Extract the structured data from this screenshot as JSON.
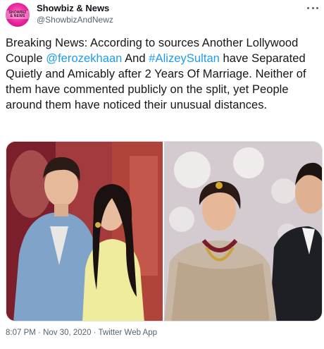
{
  "account": {
    "display_name": "Showbiz & News",
    "handle": "@ShowbizAndNewz",
    "avatar_text": "SHOWBIZ & NEWS",
    "avatar_color": "#e8249b"
  },
  "tweet": {
    "text_part1": "Breaking News: According to sources Another Lollywood Couple ",
    "mention1": "@ferozekhaan",
    "text_part2": " And ",
    "mention2": "#AlizeySultan",
    "text_part3": " have Separated Quietly and Amicably after 2 Years Of Marriage. Neither of them have commented publicly on the split, yet People around them have noticed their unusual distances.",
    "link_color": "#1d9bf0"
  },
  "media": {
    "photo_left": "couple-photo-left",
    "photo_right": "couple-photo-right"
  },
  "meta": {
    "time": "8:07 PM",
    "separator": " · ",
    "date": "Nov 30, 2020",
    "source": "Twitter Web App"
  }
}
